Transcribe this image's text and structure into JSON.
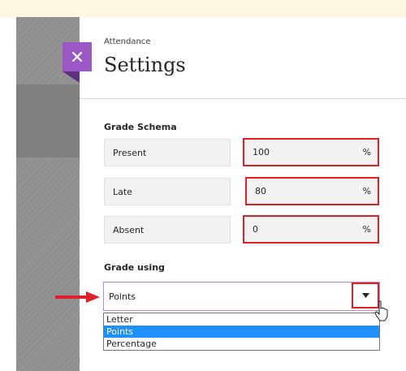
{
  "panel": {
    "breadcrumb": "Attendance",
    "title": "Settings",
    "close_icon": "close-icon"
  },
  "grade_schema": {
    "heading": "Grade Schema",
    "rows": [
      {
        "label": "Present",
        "value": "100",
        "unit": "%"
      },
      {
        "label": "Late",
        "value": "80",
        "unit": "%"
      },
      {
        "label": "Absent",
        "value": "0",
        "unit": "%"
      }
    ]
  },
  "grade_using": {
    "heading": "Grade using",
    "selected": "Points",
    "options": [
      "Letter",
      "Points",
      "Percentage"
    ],
    "highlighted_option": "Points"
  },
  "colors": {
    "accent_purple": "#9b58c4",
    "highlight_red": "#e11f26",
    "option_selected": "#1e90ff",
    "top_strip": "#fff8e1"
  },
  "annotations": {
    "pointer_arrow": "red-arrow-icon",
    "mouse_cursor": "cursor-icon"
  }
}
